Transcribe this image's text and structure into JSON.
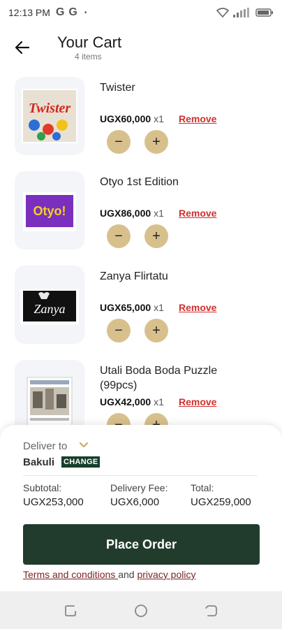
{
  "status_bar": {
    "time": "12:13 PM",
    "notif_1": "G",
    "notif_2": "G",
    "dot": "•"
  },
  "header": {
    "title": "Your Cart",
    "subtitle": "4 items"
  },
  "items": [
    {
      "name": "Twister",
      "price": "UGX60,000",
      "qty": "x1",
      "remove": "Remove",
      "minus": "−",
      "plus": "+",
      "image_text": "Twister"
    },
    {
      "name": "Otyo 1st Edition",
      "price": "UGX86,000",
      "qty": "x1",
      "remove": "Remove",
      "minus": "−",
      "plus": "+",
      "image_text": "Otyo!"
    },
    {
      "name": "Zanya Flirtatu",
      "price": "UGX65,000",
      "qty": "x1",
      "remove": "Remove",
      "minus": "−",
      "plus": "+",
      "image_text": "Zanya"
    },
    {
      "name": "Utali Boda Boda Puzzle (99pcs)",
      "price": "UGX42,000",
      "qty": "x1",
      "remove": "Remove",
      "minus": "−",
      "plus": "+"
    }
  ],
  "delivery": {
    "label": "Deliver to",
    "location": "Bakuli",
    "change": "CHANGE"
  },
  "summary": {
    "subtotal_label": "Subtotal:",
    "subtotal": "UGX253,000",
    "fee_label": "Delivery Fee:",
    "fee": "UGX6,000",
    "total_label": "Total:",
    "total": "UGX259,000"
  },
  "place_order": "Place Order",
  "legal": {
    "terms": "Terms and conditions ",
    "and": " and ",
    "privacy": "privacy policy"
  },
  "colors": {
    "accent_dark_green": "#213c2d",
    "tan": "#d8c08d",
    "remove_red": "#d32f2f"
  }
}
